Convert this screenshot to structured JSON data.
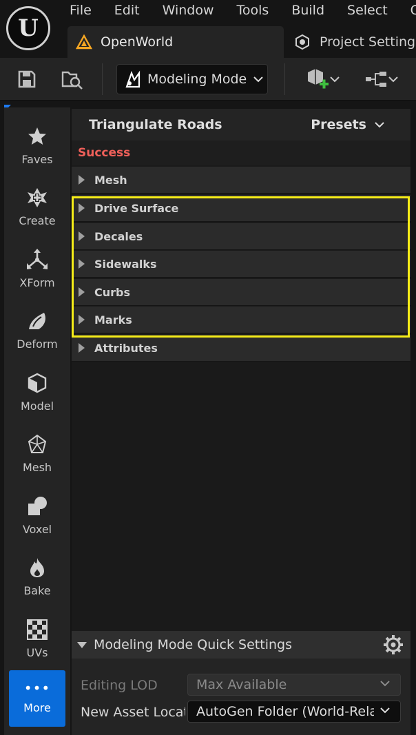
{
  "menu": [
    "File",
    "Edit",
    "Window",
    "Tools",
    "Build",
    "Select",
    "C"
  ],
  "logo_letter": "U",
  "tabs": [
    {
      "label": "OpenWorld",
      "icon": "level-icon"
    },
    {
      "label": "Project Settings",
      "icon": "settings-icon"
    }
  ],
  "toolbar": {
    "mode_label": "Modeling Mode"
  },
  "leftbar": [
    {
      "label": "Faves",
      "icon": "star-icon"
    },
    {
      "label": "Create",
      "icon": "create-icon"
    },
    {
      "label": "XForm",
      "icon": "transform-icon"
    },
    {
      "label": "Deform",
      "icon": "deform-icon"
    },
    {
      "label": "Model",
      "icon": "model-icon"
    },
    {
      "label": "Mesh",
      "icon": "mesh-icon"
    },
    {
      "label": "Voxel",
      "icon": "voxel-icon"
    },
    {
      "label": "Bake",
      "icon": "bake-icon"
    },
    {
      "label": "UVs",
      "icon": "uvs-icon"
    }
  ],
  "more_label": "More",
  "panel": {
    "title": "Triangulate Roads",
    "presets_label": "Presets",
    "status": "Success",
    "sections": [
      "Mesh",
      "Drive Surface",
      "Decales",
      "Sidewalks",
      "Curbs",
      "Marks",
      "Attributes"
    ]
  },
  "quick_settings": {
    "title": "Modeling Mode Quick Settings",
    "rows": [
      {
        "label": "Editing LOD",
        "value": "Max Available"
      },
      {
        "label": "New Asset Location",
        "value": "AutoGen Folder (World-Relative)"
      }
    ]
  },
  "colors": {
    "status_success": "#f0605a",
    "highlight": "#f5ec18",
    "accent_blue": "#0a6cda"
  }
}
